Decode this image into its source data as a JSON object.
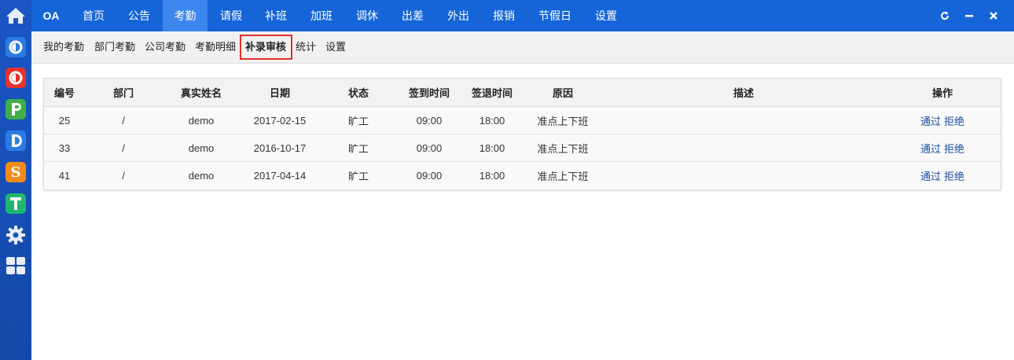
{
  "sidebar": {
    "items": [
      {
        "name": "home-icon"
      },
      {
        "name": "app-c-icon",
        "color": "#2a7be4",
        "glyph": "C"
      },
      {
        "name": "app-o-icon",
        "color": "#e5322d",
        "glyph": "O"
      },
      {
        "name": "app-p-icon",
        "color": "#3fae49",
        "glyph": "P"
      },
      {
        "name": "app-d-icon",
        "color": "#2a7be4",
        "glyph": "D"
      },
      {
        "name": "app-s-icon",
        "color": "#f08c1a",
        "glyph": "S"
      },
      {
        "name": "app-t-icon",
        "color": "#1fb573",
        "glyph": "T"
      },
      {
        "name": "gear-icon"
      },
      {
        "name": "grid-icon"
      }
    ]
  },
  "topnav": {
    "brand": "OA",
    "items": [
      "首页",
      "公告",
      "考勤",
      "请假",
      "补班",
      "加班",
      "调休",
      "出差",
      "外出",
      "报销",
      "节假日",
      "设置"
    ],
    "active": "考勤",
    "window_buttons": [
      "refresh-icon",
      "minimize-icon",
      "close-icon"
    ]
  },
  "subnav": {
    "items": [
      "我的考勤",
      "部门考勤",
      "公司考勤",
      "考勤明细",
      "补录审核",
      "统计",
      "设置"
    ],
    "active": "补录审核"
  },
  "table": {
    "headers": [
      "编号",
      "部门",
      "真实姓名",
      "日期",
      "状态",
      "签到时间",
      "签退时间",
      "原因",
      "描述",
      "操作"
    ],
    "rows": [
      {
        "id": "25",
        "dept": "/",
        "name": "demo",
        "date": "2017-02-15",
        "status": "旷工",
        "checkin": "09:00",
        "checkout": "18:00",
        "reason": "准点上下班",
        "desc": "",
        "approve": "通过",
        "reject": "拒绝"
      },
      {
        "id": "33",
        "dept": "/",
        "name": "demo",
        "date": "2016-10-17",
        "status": "旷工",
        "checkin": "09:00",
        "checkout": "18:00",
        "reason": "准点上下班",
        "desc": "",
        "approve": "通过",
        "reject": "拒绝"
      },
      {
        "id": "41",
        "dept": "/",
        "name": "demo",
        "date": "2017-04-14",
        "status": "旷工",
        "checkin": "09:00",
        "checkout": "18:00",
        "reason": "准点上下班",
        "desc": "",
        "approve": "通过",
        "reject": "拒绝"
      }
    ]
  },
  "colors": {
    "topbar": "#1565d8",
    "topbar_active": "#3d86ee",
    "sidebar": "#1a56c4",
    "highlight_border": "#e0302a",
    "link": "#1a4fa0"
  }
}
